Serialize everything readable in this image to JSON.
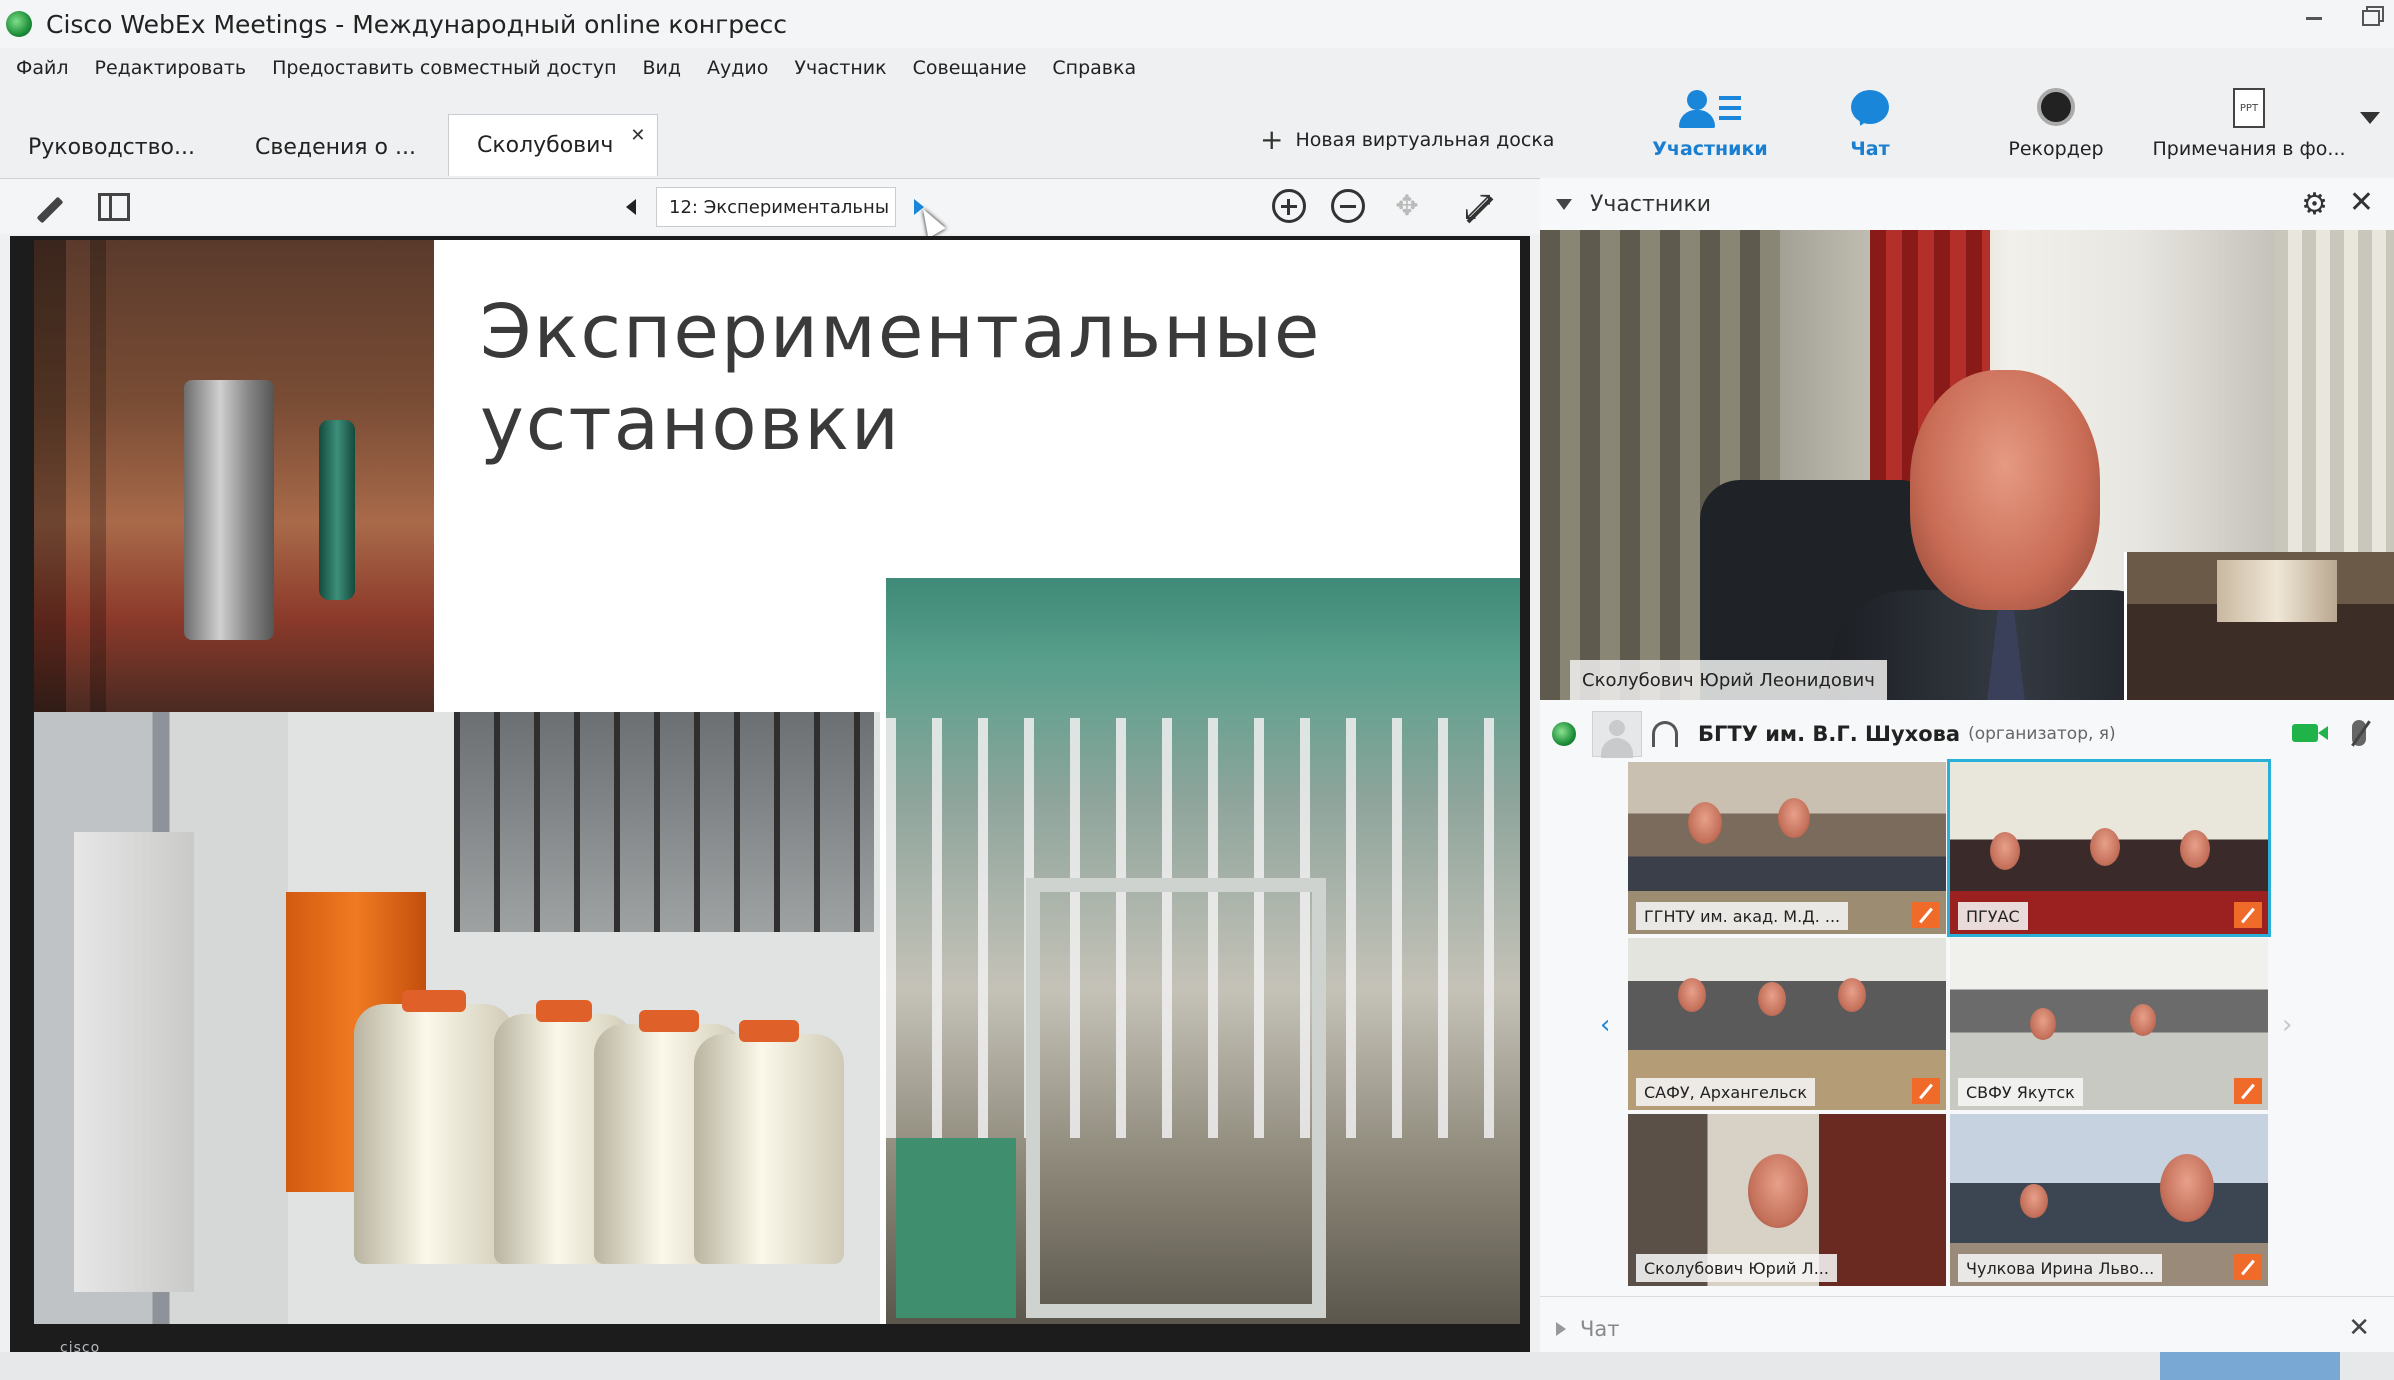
{
  "window": {
    "title": "Cisco WebEx Meetings - Международный online конгресс"
  },
  "menu": [
    "Файл",
    "Редактировать",
    "Предоставить совместный доступ",
    "Вид",
    "Аудио",
    "Участник",
    "Совещание",
    "Справка"
  ],
  "tabs": [
    {
      "label": "Руководство..."
    },
    {
      "label": "Сведения о ..."
    },
    {
      "label": "Сколубович",
      "active": true
    }
  ],
  "new_whiteboard": "Новая виртуальная доска",
  "toolbar": {
    "participants": "Участники",
    "chat": "Чат",
    "recorder": "Рекордер",
    "notes": "Примечания в фо...",
    "ppt_badge": "PPT"
  },
  "presentation": {
    "slide_selector": "12: Экспериментальны",
    "slide_title_line1": "Экспериментальные",
    "slide_title_line2": "установки"
  },
  "participants_panel": {
    "title": "Участники",
    "main_video_name": "Сколубович Юрий Леонидович",
    "host_name": "БГТУ им. В.Г. Шухова",
    "host_role": "(организатор, я)",
    "tiles": [
      {
        "label": "ГГНТУ им. акад. М.Д. ...",
        "muted": true
      },
      {
        "label": "ПГУАС",
        "muted": true,
        "selected": true
      },
      {
        "label": "САФУ, Архангельск",
        "muted": true
      },
      {
        "label": "СВФУ Якутск",
        "muted": true
      },
      {
        "label": "Сколубович Юрий Л...",
        "muted": false
      },
      {
        "label": "Чулкова Ирина Льво...",
        "muted": true
      }
    ]
  },
  "chat_panel": {
    "title": "Чат"
  },
  "footer": {
    "brand": "cisco"
  },
  "colors": {
    "accent": "#1a86d9",
    "mute": "#f06a2a",
    "selected": "#2ab0d8",
    "camera": "#1fb34a"
  }
}
